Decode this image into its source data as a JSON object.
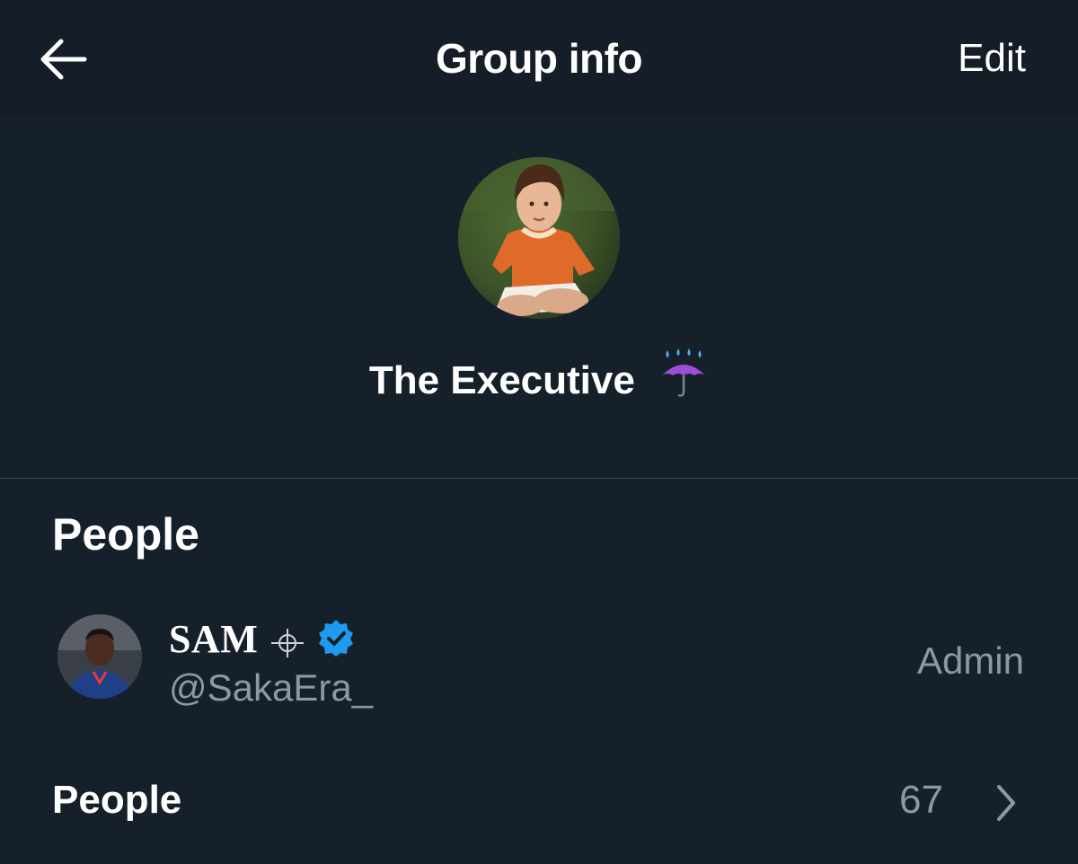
{
  "header": {
    "title": "Group info",
    "edit_label": "Edit",
    "back_icon": "arrow-left-icon"
  },
  "group": {
    "name": "The Executive",
    "name_emoji_icon": "umbrella-with-rain-icon",
    "avatar": "group-avatar-photo"
  },
  "people_section": {
    "title": "People",
    "members": [
      {
        "display_name": "SAM",
        "handle": "@SakaEra_",
        "role": "Admin",
        "badges": [
          "crosshair-icon",
          "verified-badge-icon"
        ],
        "avatar": "member-avatar-photo"
      }
    ],
    "all_people_label": "People",
    "count": "67",
    "chevron_icon": "chevron-right-icon"
  },
  "colors": {
    "background": "#16202b",
    "header_background": "#141d28",
    "primary_text": "#ffffff",
    "secondary_text": "#8b98a5",
    "verified_blue": "#1d9bf0",
    "divider": "#3a4653"
  }
}
